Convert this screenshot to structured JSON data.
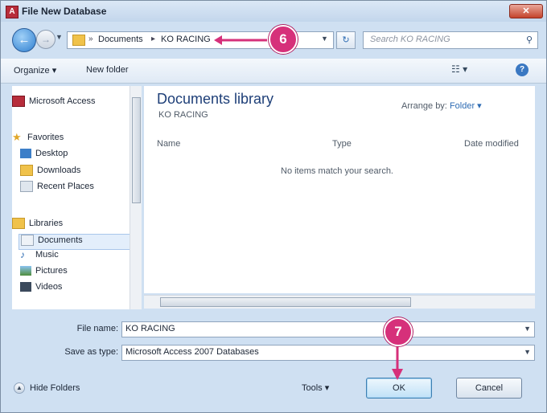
{
  "window": {
    "title": "File New Database",
    "close_glyph": "✕"
  },
  "nav": {
    "back_glyph": "←",
    "forward_glyph": "→",
    "breadcrumb": [
      "Documents",
      "KO RACING"
    ],
    "search_placeholder": "Search KO RACING",
    "refresh_glyph": "↻"
  },
  "callouts": {
    "step6": "6",
    "step7": "7"
  },
  "toolbar": {
    "organize": "Organize ▾",
    "new_folder": "New folder",
    "views": "☷ ▾",
    "help": "?"
  },
  "sidebar": {
    "favorites_header": "Favorites",
    "favorites": [
      "Desktop",
      "Downloads",
      "Recent Places"
    ],
    "top_item": "Microsoft Access",
    "libraries_header": "Libraries",
    "libraries": [
      "Documents",
      "Music",
      "Pictures",
      "Videos"
    ]
  },
  "library": {
    "title": "Documents library",
    "subtitle": "KO RACING",
    "arrange_label": "Arrange by:",
    "arrange_value": "Folder ▾",
    "columns": [
      "Name",
      "Type",
      "Date modified"
    ],
    "empty_message": "No items match your search."
  },
  "form": {
    "filename_label": "File name:",
    "filename_value": "KO RACING",
    "savetype_label": "Save as type:",
    "savetype_value": "Microsoft Access 2007 Databases"
  },
  "footer": {
    "hide_folders": "Hide Folders",
    "tools": "Tools ▾",
    "ok": "OK",
    "cancel": "Cancel"
  },
  "colors": {
    "callout": "#d6307a",
    "folder": "#f0c24a",
    "accent": "#2d6bb3"
  },
  "icons": {
    "app": "access-icon",
    "favorites": "star-icon",
    "desktop": "desktop-icon",
    "downloads": "downloads-icon",
    "recent": "recent-places-icon",
    "libraries": "libraries-icon",
    "documents": "documents-icon",
    "music": "music-icon",
    "pictures": "pictures-icon",
    "videos": "videos-icon"
  }
}
